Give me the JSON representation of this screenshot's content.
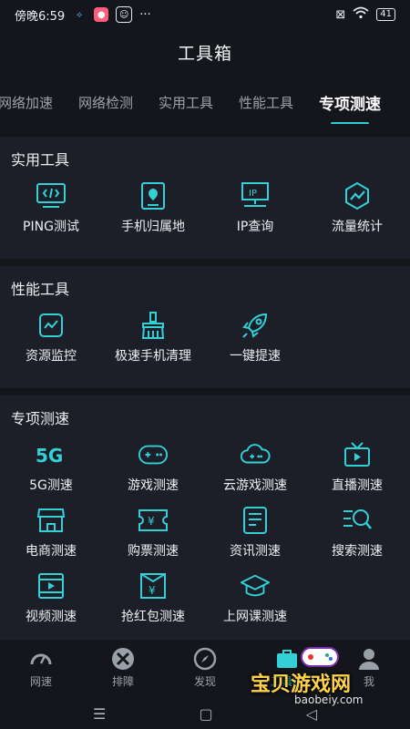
{
  "status": {
    "time": "傍晚6:59",
    "battery": "41"
  },
  "header": {
    "title": "工具箱"
  },
  "tabs": [
    "网络加速",
    "网络检测",
    "实用工具",
    "性能工具",
    "专项测速"
  ],
  "sections": [
    {
      "title": "实用工具",
      "items": [
        {
          "label": "PING测试",
          "icon": "code-monitor-icon"
        },
        {
          "label": "手机归属地",
          "icon": "location-phone-icon"
        },
        {
          "label": "IP查询",
          "icon": "ip-monitor-icon"
        },
        {
          "label": "流量统计",
          "icon": "traffic-chart-icon"
        }
      ]
    },
    {
      "title": "性能工具",
      "items": [
        {
          "label": "资源监控",
          "icon": "resource-monitor-icon"
        },
        {
          "label": "极速手机清理",
          "icon": "broom-icon"
        },
        {
          "label": "一键提速",
          "icon": "rocket-icon"
        }
      ]
    },
    {
      "title": "专项测速",
      "items": [
        {
          "label": "5G测速",
          "icon": "5g-icon"
        },
        {
          "label": "游戏测速",
          "icon": "gamepad-icon"
        },
        {
          "label": "云游戏测速",
          "icon": "cloud-game-icon"
        },
        {
          "label": "直播测速",
          "icon": "live-tv-icon"
        },
        {
          "label": "电商测速",
          "icon": "shop-icon"
        },
        {
          "label": "购票测速",
          "icon": "ticket-icon"
        },
        {
          "label": "资讯测速",
          "icon": "news-icon"
        },
        {
          "label": "搜索测速",
          "icon": "search-list-icon"
        },
        {
          "label": "视频测速",
          "icon": "video-icon"
        },
        {
          "label": "抢红包测速",
          "icon": "red-envelope-icon"
        },
        {
          "label": "上网课测速",
          "icon": "graduation-cap-icon"
        }
      ]
    }
  ],
  "bottom_nav": [
    {
      "label": "网速",
      "icon": "speedometer-icon"
    },
    {
      "label": "排障",
      "icon": "tools-icon"
    },
    {
      "label": "发现",
      "icon": "compass-icon"
    },
    {
      "label": "工具箱",
      "icon": "toolbox-icon"
    },
    {
      "label": "我",
      "icon": "user-icon"
    }
  ],
  "watermark": {
    "text": "宝贝游戏网",
    "url": "baobeiy.com"
  },
  "colors": {
    "accent": "#33d0d6",
    "background": "#14161c",
    "card": "#1c1f27"
  }
}
